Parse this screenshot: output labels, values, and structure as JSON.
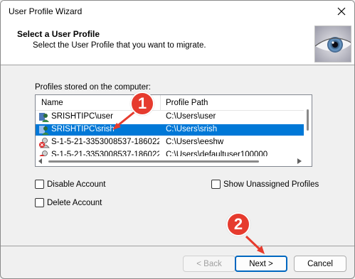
{
  "window": {
    "title": "User Profile Wizard",
    "close_icon": "close-icon"
  },
  "header": {
    "title": "Select a User Profile",
    "subtitle": "Select the User Profile that you want to migrate."
  },
  "profiles": {
    "group_label": "Profiles stored on the computer:",
    "columns": [
      "Name",
      "Profile Path"
    ],
    "rows": [
      {
        "name": "SRISHTIPC\\user",
        "path": "C:\\Users\\user",
        "icon": "user-profile-icon",
        "selected": false
      },
      {
        "name": "SRISHTIPC\\srish",
        "path": "C:\\Users\\srish",
        "icon": "user-profile-icon",
        "selected": true
      },
      {
        "name": "S-1-5-21-3353008537-186022...",
        "path": "C:\\Users\\eeshw",
        "icon": "unknown-profile-icon",
        "selected": false
      },
      {
        "name": "S-1-5-21-3353008537-186022...",
        "path": "C:\\Users\\defaultuser100000",
        "icon": "unknown-profile-icon",
        "selected": false
      }
    ]
  },
  "options": {
    "disable_account": "Disable Account",
    "delete_account": "Delete Account",
    "show_unassigned": "Show Unassigned Profiles"
  },
  "buttons": {
    "back": "< Back",
    "next": "Next >",
    "cancel": "Cancel"
  },
  "annotations": {
    "badge1": "1",
    "badge2": "2",
    "color": "#e63b2e"
  },
  "colors": {
    "selection": "#0078d7",
    "primary_border": "#0067c0"
  }
}
